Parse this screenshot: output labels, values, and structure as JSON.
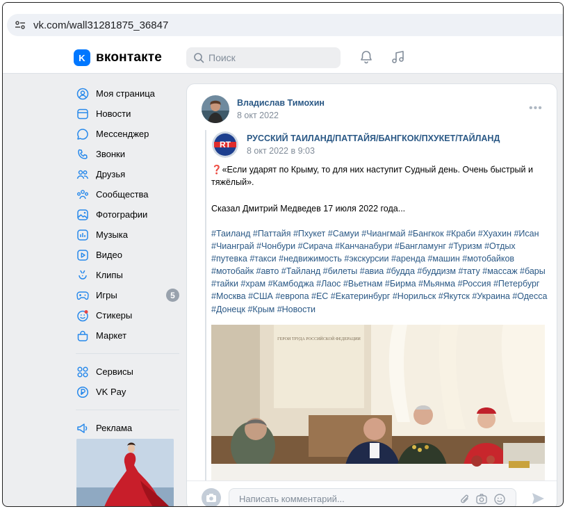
{
  "browser": {
    "url": "vk.com/wall31281875_36847"
  },
  "header": {
    "logo_text": "вконтакте",
    "logo_mark": "K",
    "search_placeholder": "Поиск"
  },
  "sidebar": {
    "items": [
      {
        "label": "Моя страница",
        "icon": "profile-icon"
      },
      {
        "label": "Новости",
        "icon": "news-icon"
      },
      {
        "label": "Мессенджер",
        "icon": "messenger-icon"
      },
      {
        "label": "Звонки",
        "icon": "phone-icon"
      },
      {
        "label": "Друзья",
        "icon": "friends-icon"
      },
      {
        "label": "Сообщества",
        "icon": "communities-icon"
      },
      {
        "label": "Фотографии",
        "icon": "photos-icon"
      },
      {
        "label": "Музыка",
        "icon": "music-icon"
      },
      {
        "label": "Видео",
        "icon": "video-icon"
      },
      {
        "label": "Клипы",
        "icon": "clips-icon"
      },
      {
        "label": "Игры",
        "icon": "games-icon",
        "badge": "5"
      },
      {
        "label": "Стикеры",
        "icon": "stickers-icon"
      },
      {
        "label": "Маркет",
        "icon": "market-icon"
      }
    ],
    "items2": [
      {
        "label": "Сервисы",
        "icon": "services-icon"
      },
      {
        "label": "VK Pay",
        "icon": "vkpay-icon"
      }
    ],
    "items3": [
      {
        "label": "Реклама",
        "icon": "ads-icon"
      }
    ]
  },
  "post": {
    "author": "Владислав Тимохин",
    "date": "8 окт 2022",
    "repost": {
      "group": "РУССКИЙ ТАИЛАНД/ПАТТАЙЯ/БАНГКОК/ПХУКЕТ/ТАЙЛАНД",
      "date": "8 окт 2022 в 9:03",
      "avatar_text": "RT"
    },
    "quote_mark": "❓",
    "text1": "«Если ударят по Крыму, то для них наступит Судный день. Очень быстрый и тяжёлый».",
    "text2": "Сказал Дмитрий Медведев 17 июля 2022 года...",
    "hashtags": "#Таиланд #Паттайя #Пхукет #Самуи #Чиангмай #Бангкок #Краби #Хуахин #Исан #Чианграй #Чонбури #Сирача #Канчанабури #Бангламунг #Туризм #Отдых #путевка #такси #недвижимость #экскурсии #аренда #машин #мотобайков #мотобайк #авто #Тайланд #билеты #авиа #будда #буддизм #тату #массаж #бары #тайки #храм #Камбоджа #Лаос #Вьетнам #Бирма #Мьянма #Россия #Петербург #Москва #США #европа #ЕС #Екатеринбург #Норильск #Якутск #Украина #Одесса #Донецк #Крым #Новости",
    "photo_plaque": "ГЕРОИ ТРУДА РОССИЙСКОЙ ФЕДЕРАЦИИ",
    "comment_placeholder": "Написать комментарий..."
  },
  "colors": {
    "accent": "#0077ff",
    "link": "#2a5885",
    "muted": "#818c99",
    "page_bg": "#edeef0"
  }
}
